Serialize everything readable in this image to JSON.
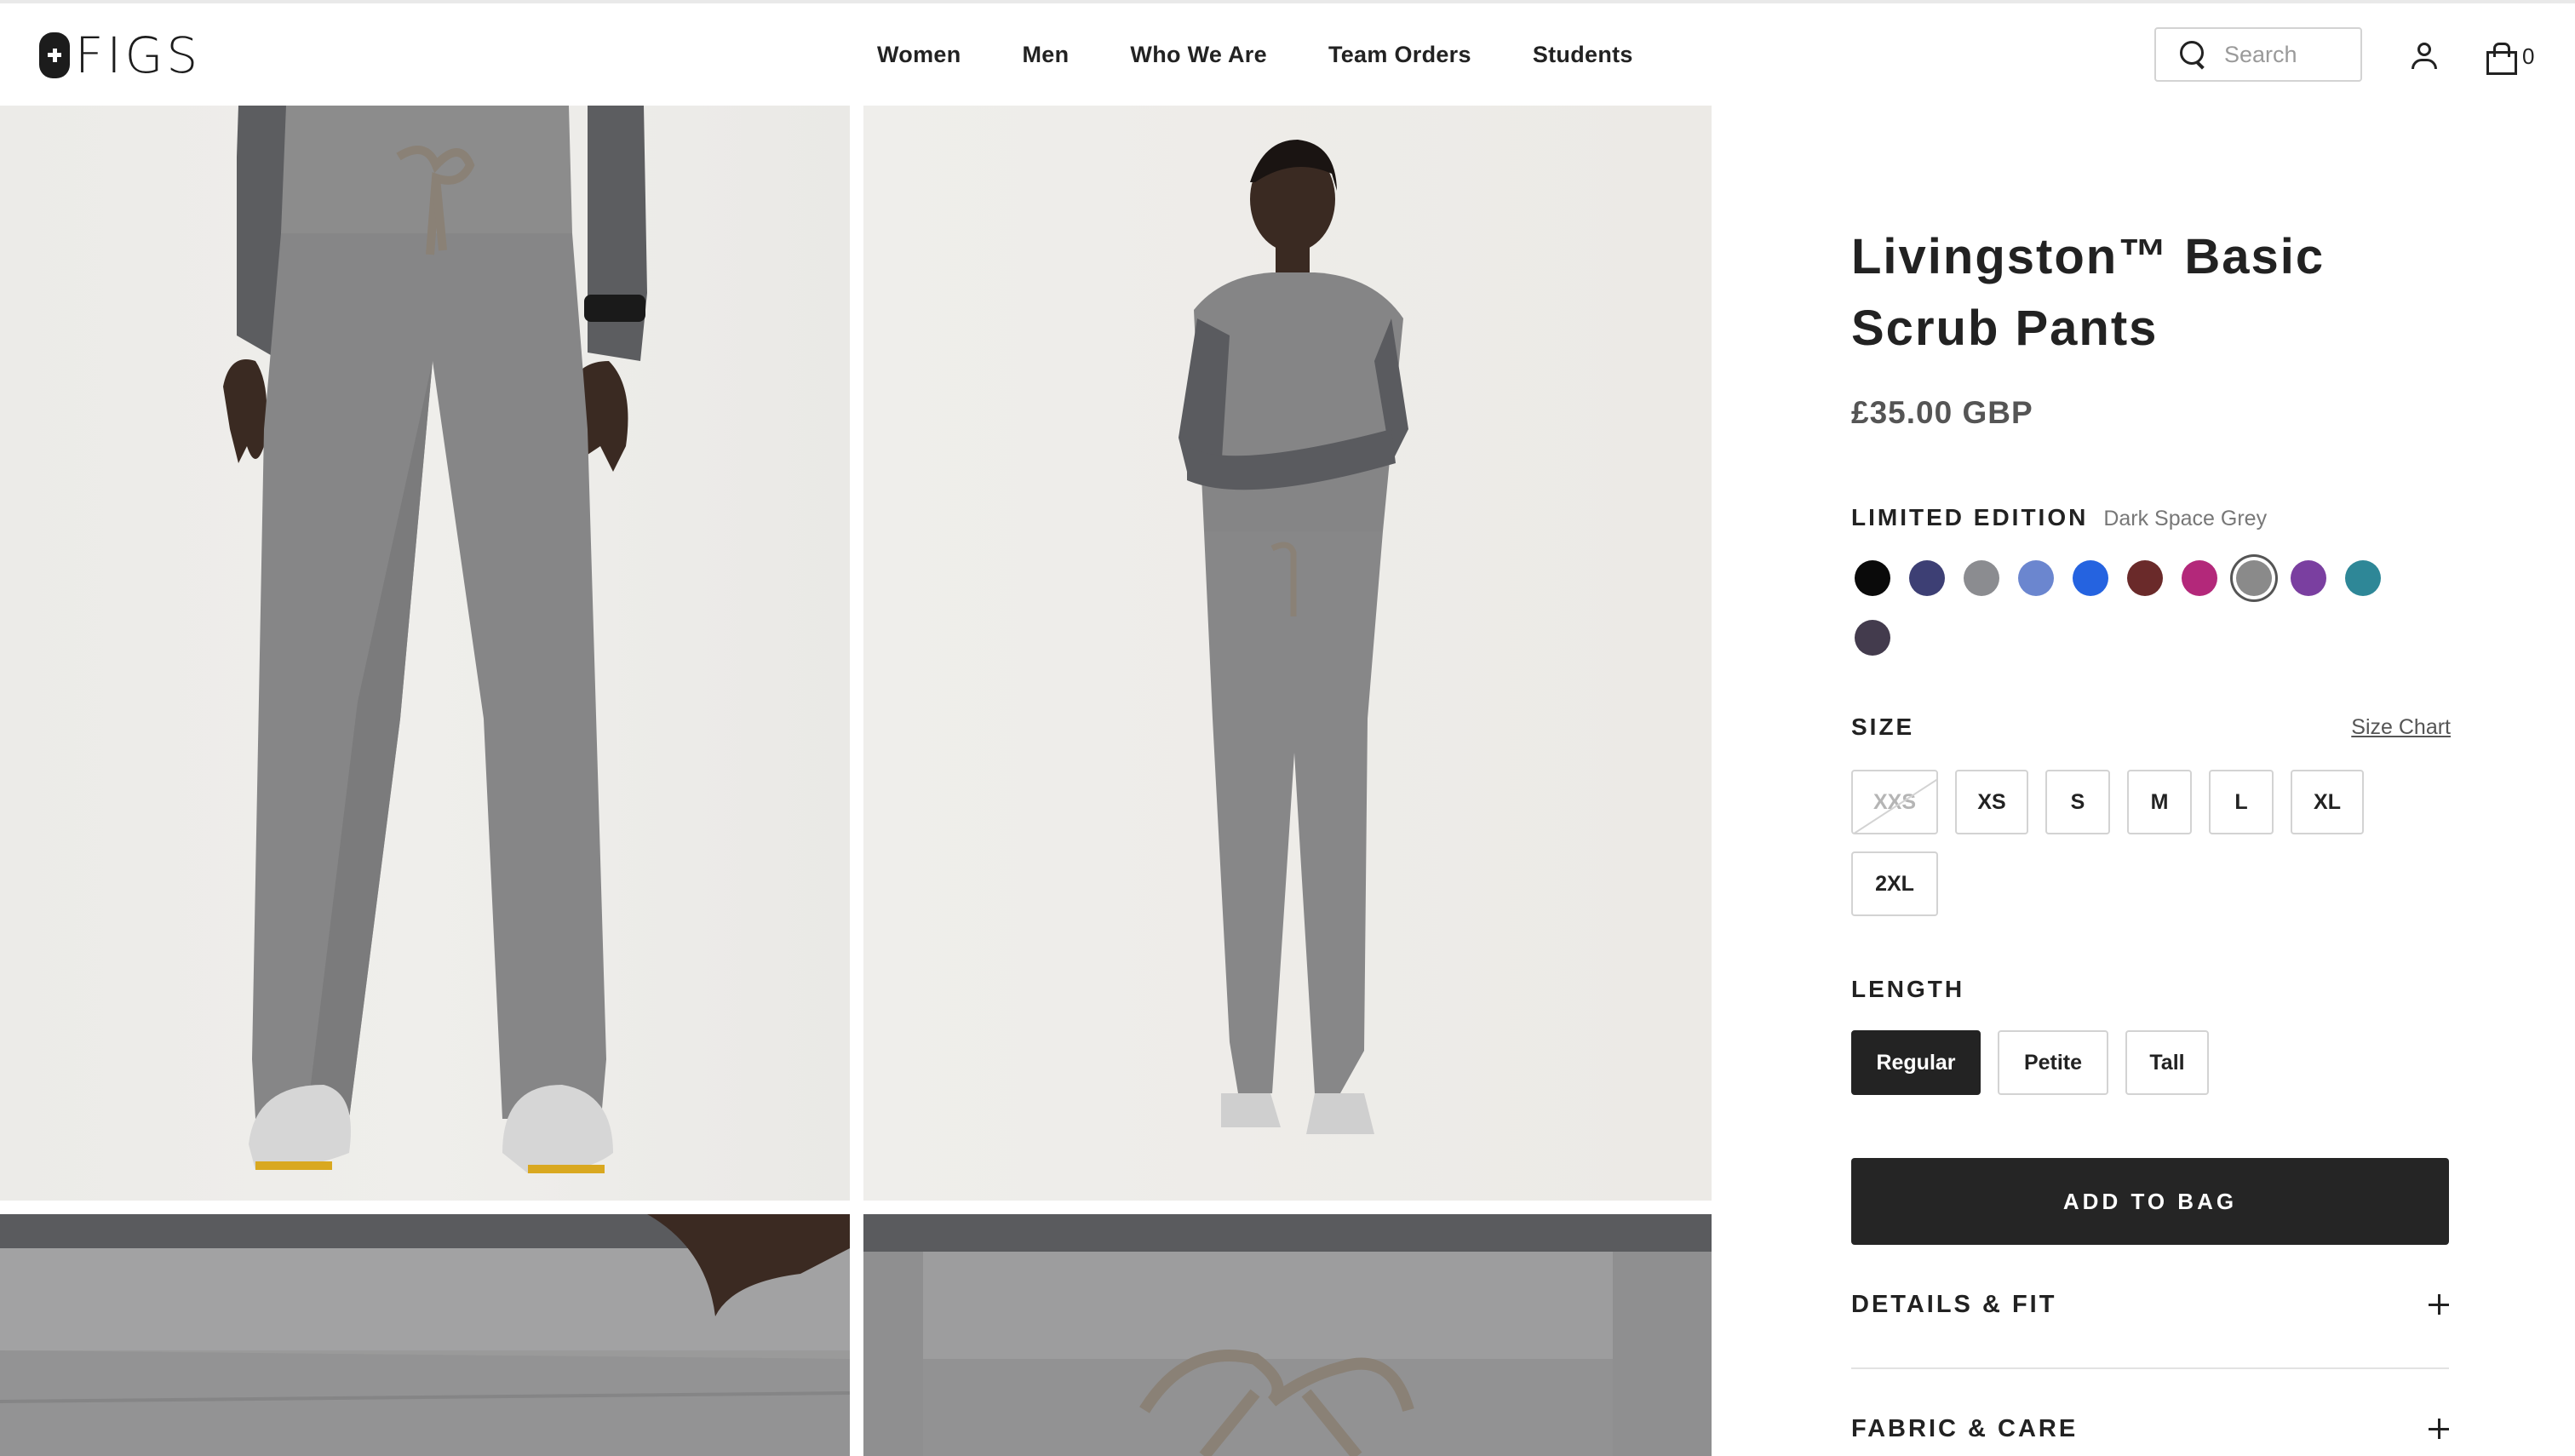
{
  "header": {
    "logo_text": "FIGS",
    "nav": [
      "Women",
      "Men",
      "Who We Are",
      "Team Orders",
      "Students"
    ],
    "search_placeholder": "Search",
    "bag_count": "0"
  },
  "product": {
    "title": "Livingston™ Basic Scrub Pants",
    "price": "£35.00 GBP",
    "color_label": "LIMITED EDITION",
    "selected_color": "Dark Space Grey",
    "colors": [
      {
        "hex": "#0a0a0a",
        "selected": false
      },
      {
        "hex": "#3d3f74",
        "selected": false
      },
      {
        "hex": "#8b8c90",
        "selected": false
      },
      {
        "hex": "#6b86cf",
        "selected": false
      },
      {
        "hex": "#2563e0",
        "selected": false
      },
      {
        "hex": "#6a2a2a",
        "selected": false
      },
      {
        "hex": "#b3287a",
        "selected": false
      },
      {
        "hex": "#8a8a8a",
        "selected": true
      },
      {
        "hex": "#7a3fa0",
        "selected": false
      },
      {
        "hex": "#2e8797",
        "selected": false
      },
      {
        "hex": "#433b4d",
        "selected": false
      }
    ],
    "size_label": "SIZE",
    "size_chart_link": "Size Chart",
    "sizes": [
      {
        "label": "XXS",
        "available": false
      },
      {
        "label": "XS",
        "available": true
      },
      {
        "label": "S",
        "available": true
      },
      {
        "label": "M",
        "available": true
      },
      {
        "label": "L",
        "available": true
      },
      {
        "label": "XL",
        "available": true
      },
      {
        "label": "2XL",
        "available": true
      }
    ],
    "length_label": "LENGTH",
    "lengths": [
      {
        "label": "Regular",
        "selected": true
      },
      {
        "label": "Petite",
        "selected": false
      },
      {
        "label": "Tall",
        "selected": false
      }
    ],
    "add_to_bag": "ADD TO BAG",
    "accordions": [
      "DETAILS & FIT",
      "FABRIC & CARE"
    ]
  }
}
